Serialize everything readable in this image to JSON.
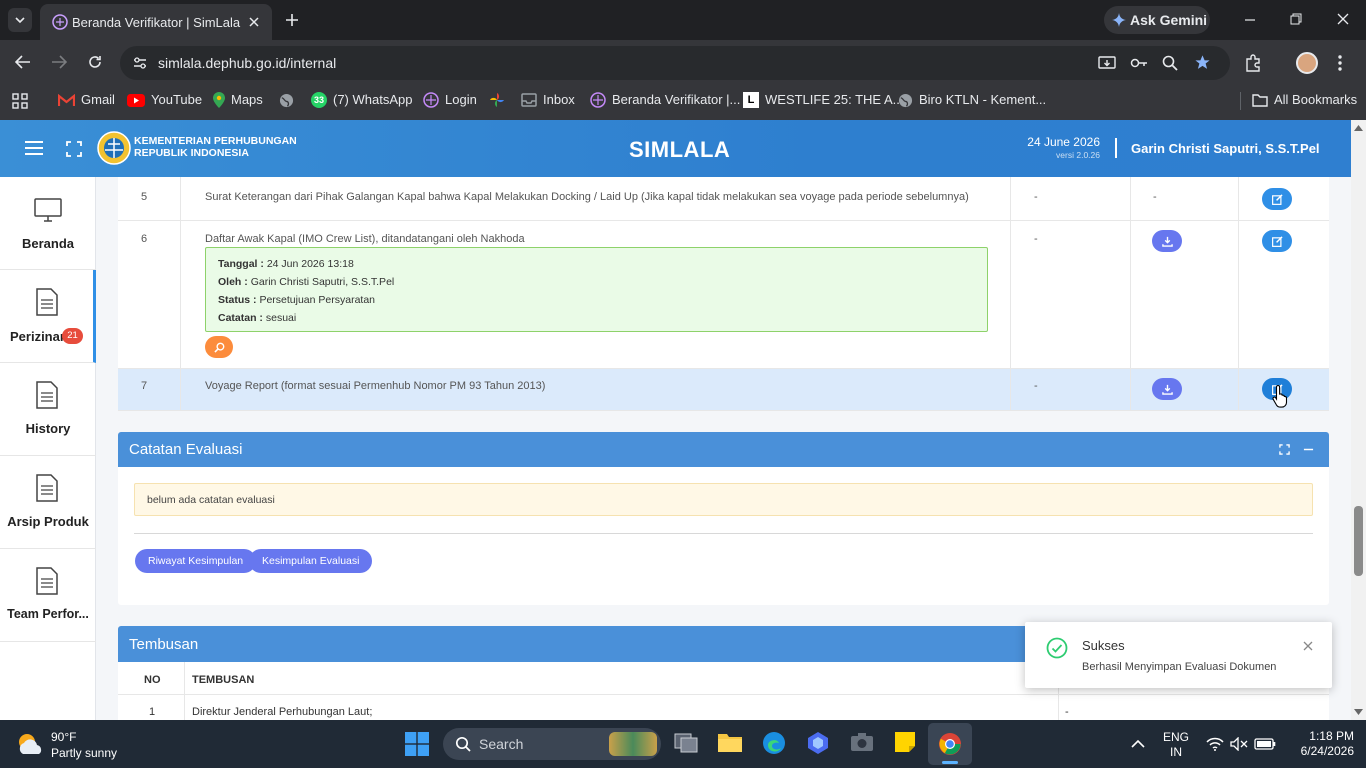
{
  "browser": {
    "tab_title": "Beranda Verifikator | SimLala",
    "url": "simlala.dephub.go.id/internal",
    "ask_gemini": "Ask Gemini",
    "bookmarks": [
      {
        "label": "Gmail",
        "icon": "gmail-icon"
      },
      {
        "label": "YouTube",
        "icon": "youtube-icon"
      },
      {
        "label": "Maps",
        "icon": "maps-icon"
      },
      {
        "label": "",
        "icon": "globe-icon"
      },
      {
        "label": "(7) WhatsApp",
        "icon": "whatsapp-icon",
        "badge": "33"
      },
      {
        "label": "Login",
        "icon": "login-site-icon"
      },
      {
        "label": "",
        "icon": "pinwheel-icon"
      },
      {
        "label": "Inbox",
        "icon": "inbox-icon"
      },
      {
        "label": "Beranda Verifikator |...",
        "icon": "simlala-icon"
      },
      {
        "label": "WESTLIFE 25: THE A...",
        "icon": "letter-l-icon"
      },
      {
        "label": "Biro KTLN - Kement...",
        "icon": "globe-icon"
      }
    ],
    "all_bookmarks": "All Bookmarks"
  },
  "header": {
    "org_line1": "KEMENTERIAN PERHUBUNGAN",
    "org_line2": "REPUBLIK INDONESIA",
    "app_title": "SIMLALA",
    "date": "24 June 2026",
    "version": "versi 2.0.26",
    "user": "Garin Christi Saputri, S.S.T.Pel"
  },
  "sidebar": {
    "items": [
      {
        "label": "Beranda",
        "icon": "monitor-icon"
      },
      {
        "label": "Perizinan",
        "icon": "document-icon",
        "badge": "21"
      },
      {
        "label": "History",
        "icon": "document-icon"
      },
      {
        "label": "Arsip Produk",
        "icon": "document-icon"
      },
      {
        "label": "Team Perfor...",
        "icon": "document-icon"
      }
    ]
  },
  "docs": {
    "rows": [
      {
        "no": "5",
        "name": "Surat Keterangan dari Pihak Galangan Kapal bahwa Kapal Melakukan Docking / Laid Up (Jika kapal tidak melakukan sea voyage pada periode sebelumnya)",
        "col3": "-",
        "col4": "-"
      },
      {
        "no": "6",
        "name": "Daftar Awak Kapal (IMO Crew List), ditandatangani oleh Nakhoda",
        "col3": "-"
      },
      {
        "no": "7",
        "name": "Voyage Report (format sesuai Permenhub Nomor PM 93 Tahun 2013)",
        "col3": "-"
      }
    ],
    "eval": {
      "tanggal_label": "Tanggal :",
      "tanggal": "24 Jun 2026 13:18",
      "oleh_label": "Oleh :",
      "oleh": "Garin Christi Saputri, S.S.T.Pel",
      "status_label": "Status :",
      "status": "Persetujuan Persyaratan",
      "catatan_label": "Catatan :",
      "catatan": "sesuai"
    }
  },
  "catatan": {
    "title": "Catatan Evaluasi",
    "empty": "belum ada catatan evaluasi",
    "btn_riwayat": "Riwayat Kesimpulan",
    "btn_kesimpulan": "Kesimpulan Evaluasi"
  },
  "tembusan": {
    "title": "Tembusan",
    "col_no": "NO",
    "col_name": "TEMBUSAN",
    "rows": [
      {
        "no": "1",
        "name": "Direktur Jenderal Perhubungan Laut;",
        "col3": "-"
      }
    ]
  },
  "toast": {
    "title": "Sukses",
    "message": "Berhasil Menyimpan Evaluasi Dokumen"
  },
  "taskbar": {
    "temp": "90°F",
    "weather": "Partly sunny",
    "search": "Search",
    "lang1": "ENG",
    "lang2": "IN",
    "time": "1:18 PM",
    "date": "6/24/2026"
  },
  "colors": {
    "accent": "#2f8fe6",
    "card_header": "#4a90d9",
    "success": "#2ecc71",
    "pill": "#6777ef"
  }
}
